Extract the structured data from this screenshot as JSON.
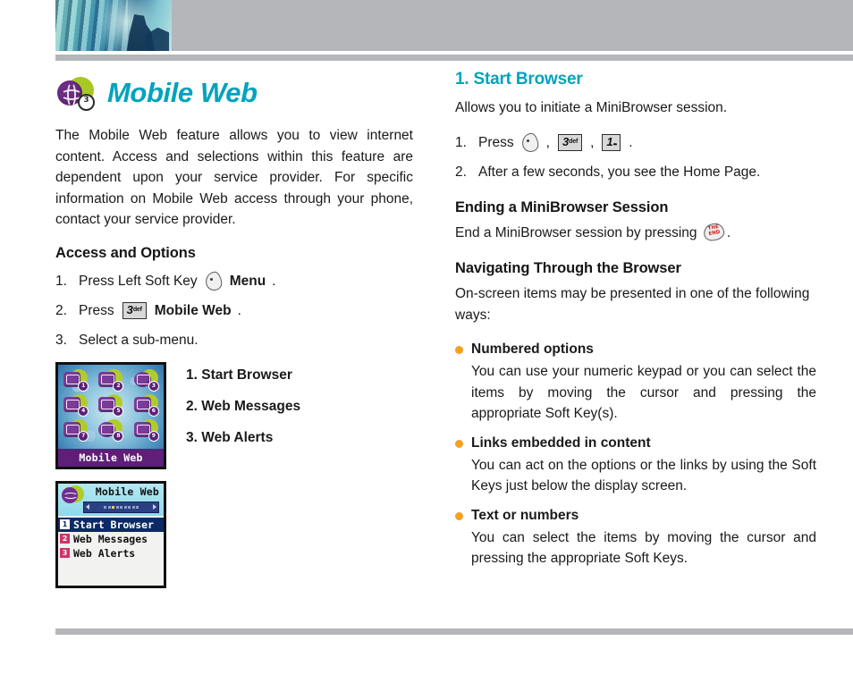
{
  "header": {
    "photo_alt": "abstract-blue-architecture-photo",
    "band_color": "#b4b6b9"
  },
  "colors": {
    "teal": "#00a3bd",
    "orange_bullet": "#f5a01e",
    "rule_gray": "#b4b6b9",
    "purple": "#6d2d82",
    "lime": "#a8c923"
  },
  "left_column": {
    "title": "Mobile Web",
    "title_badge": "3",
    "intro": "The Mobile Web feature allows you to view internet content. Access and selections within this feature are dependent upon your service provider. For specific information on Mobile Web access through your phone, contact your service provider.",
    "section_heading": "Access and Options",
    "steps": [
      {
        "num": "1.",
        "pre": "Press Left Soft Key",
        "key": "soft-key",
        "bold": "Menu",
        "post": "."
      },
      {
        "num": "2.",
        "pre": "Press",
        "key": "3def",
        "key_digit": "3",
        "key_letters": "def",
        "bold": "Mobile Web",
        "post": "."
      },
      {
        "num": "3.",
        "pre": "Select a sub-menu.",
        "bold": "",
        "post": ""
      }
    ],
    "menu_grid_shot": {
      "footer_label": "Mobile Web",
      "icon_badges": [
        "1",
        "2",
        "3",
        "4",
        "5",
        "6",
        "7",
        "8",
        "9"
      ]
    },
    "menu_list_shot": {
      "title": "Mobile Web",
      "scroll_dots": 9,
      "scroll_active_index": 2,
      "rows": [
        {
          "badge": "1",
          "label": "Start Browser",
          "selected": true
        },
        {
          "badge": "2",
          "label": "Web Messages",
          "selected": false
        },
        {
          "badge": "3",
          "label": "Web Alerts",
          "selected": false
        }
      ]
    },
    "menu_labels": [
      "1. Start Browser",
      "2. Web Messages",
      "3. Web Alerts"
    ]
  },
  "right_column": {
    "heading": "1. Start Browser",
    "intro": "Allows you to initiate a MiniBrowser session.",
    "steps": [
      {
        "num": "1.",
        "pre": "Press",
        "keys": [
          "soft-key",
          "3def",
          "1"
        ],
        "key2_digit": "3",
        "key2_letters": "def",
        "key3_digit": "1",
        "post": "."
      },
      {
        "num": "2.",
        "text": "After a few seconds, you see the Home Page."
      }
    ],
    "section_ending": {
      "heading": "Ending a MiniBrowser Session",
      "text_pre": "End a MiniBrowser session by pressing",
      "key": "end-key",
      "key_label_line1": "THE",
      "key_label_line2": "END",
      "text_post": "."
    },
    "section_navigating": {
      "heading": "Navigating Through the Browser",
      "intro": "On-screen items may be presented in one of the following ways:",
      "bullets": [
        {
          "title": "Numbered options",
          "body": "You can use your numeric keypad or you can select the items by moving the cursor and pressing the appropriate Soft Key(s)."
        },
        {
          "title": "Links embedded in content",
          "body": "You can act on the options or the links by using the Soft Keys just below the display screen."
        },
        {
          "title": "Text or numbers",
          "body": "You can select the items by moving the cursor and pressing the appropriate Soft Keys."
        }
      ]
    }
  }
}
